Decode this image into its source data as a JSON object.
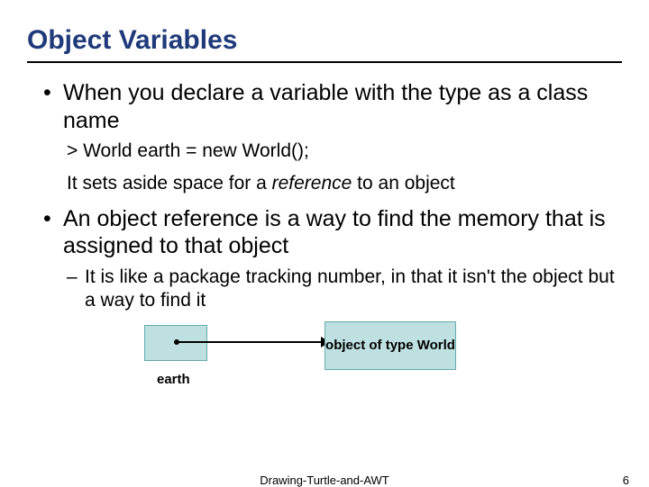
{
  "title": "Object Variables",
  "bullets": [
    {
      "text": "When you declare a variable with the type as a class name",
      "subs": [
        {
          "type": "plain",
          "text": "> World earth = new World();"
        },
        {
          "type": "ref",
          "prefix": "It sets aside space for a ",
          "italic": "reference",
          "suffix": " to an object"
        }
      ]
    },
    {
      "text": "An object reference is a way to find the memory that is assigned to that object",
      "dashes": [
        "It is like a package tracking number, in that it isn't the object but a way to find it"
      ]
    }
  ],
  "diagram": {
    "var_label": "earth",
    "obj_label": "object of type World"
  },
  "footer": {
    "source": "Drawing-Turtle-and-AWT",
    "page": "6"
  }
}
